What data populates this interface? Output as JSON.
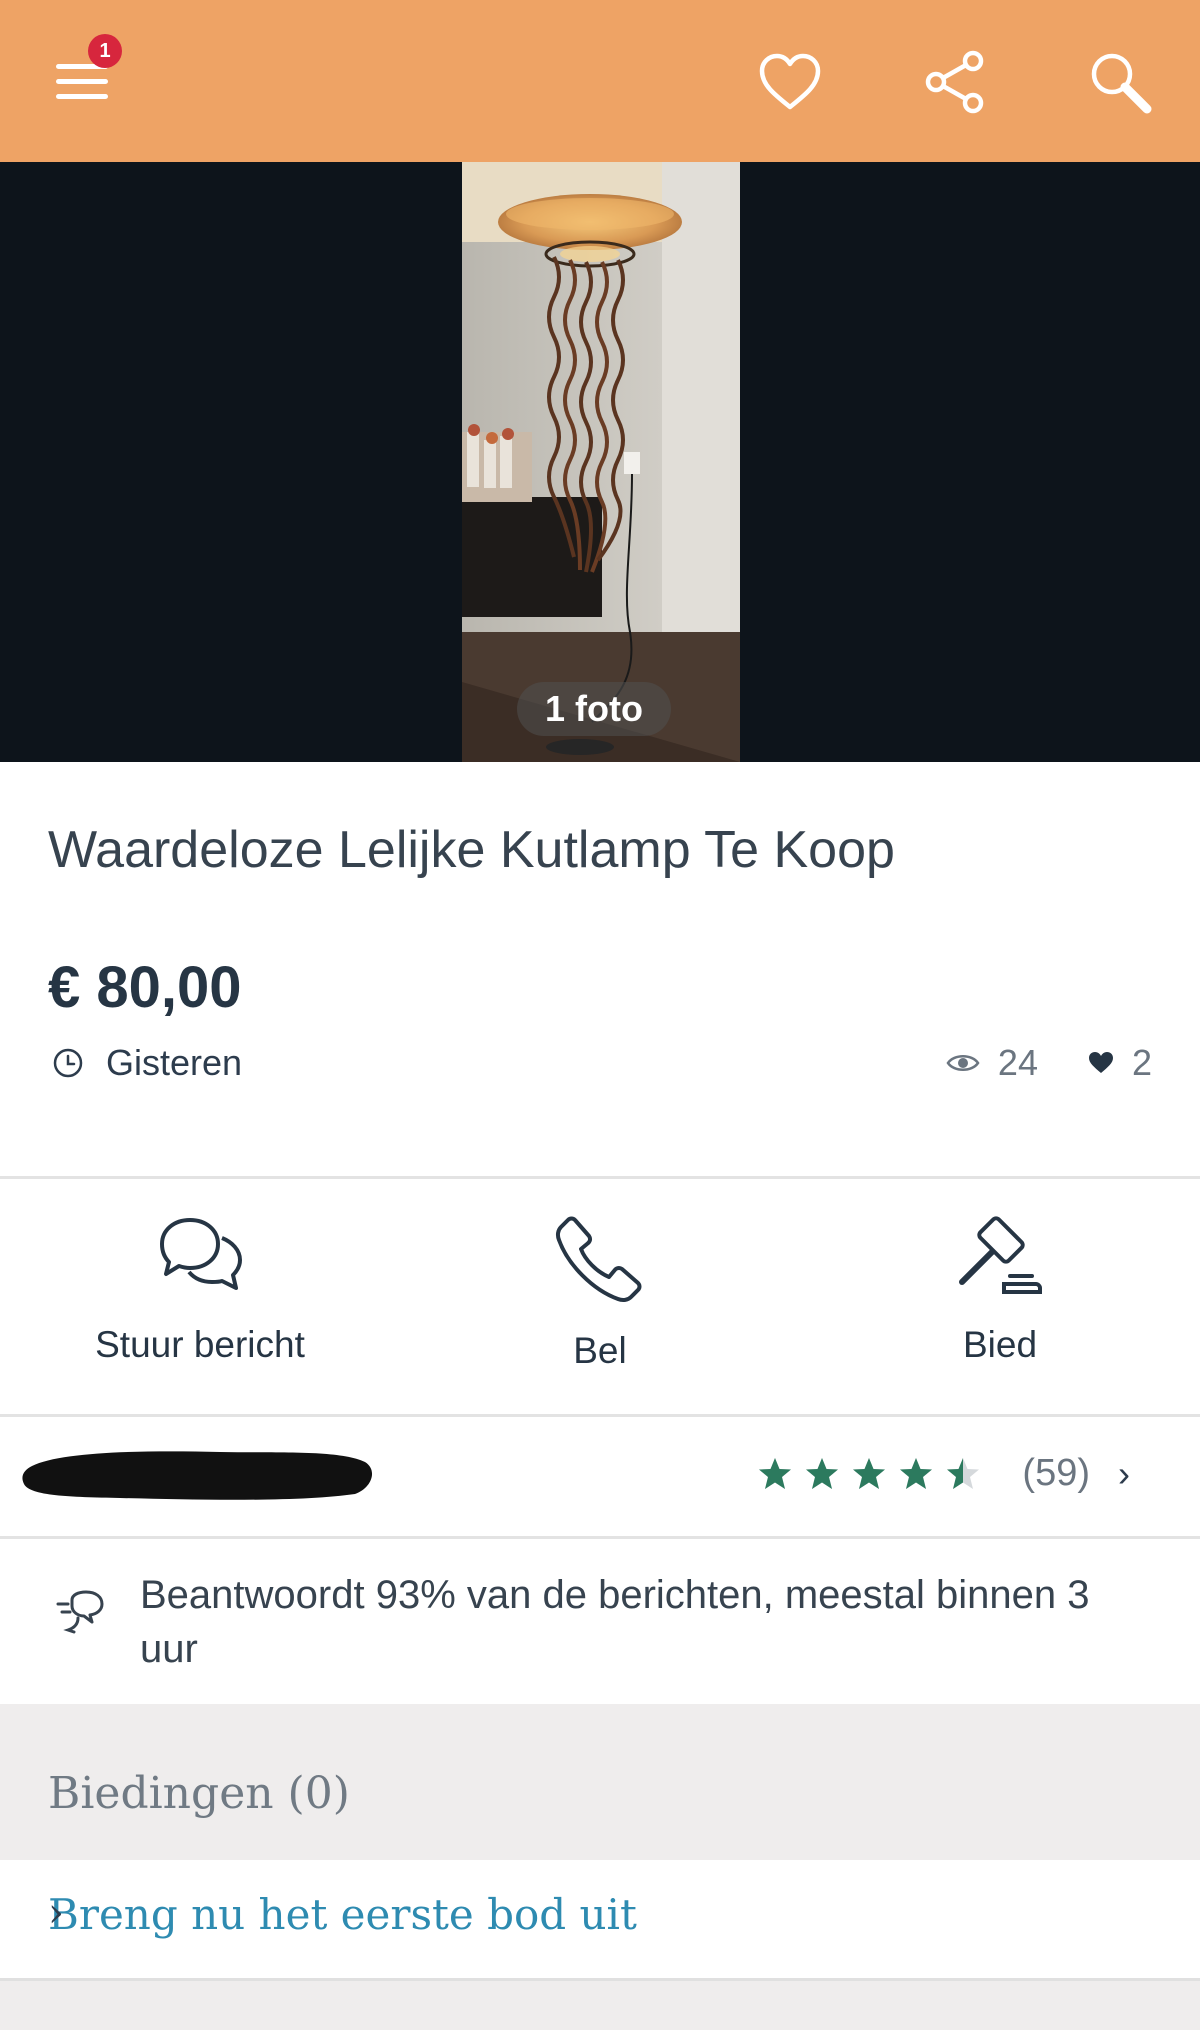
{
  "topbar": {
    "menu_icon": "hamburger-menu-icon",
    "notification_count": "1",
    "favorite_icon": "heart-outline-icon",
    "share_icon": "share-icon",
    "search_icon": "search-icon",
    "background_color": "#eea365"
  },
  "photo": {
    "count_label": "1 foto",
    "background_color": "#0d141b"
  },
  "listing": {
    "title": "Waardeloze Lelijke Kutlamp Te Koop",
    "price": "€ 80,00",
    "posted": "Gisteren",
    "views": "24",
    "favorites": "2"
  },
  "actions": [
    {
      "label": "Stuur bericht",
      "icon": "chat-bubbles-icon"
    },
    {
      "label": "Bel",
      "icon": "phone-icon"
    },
    {
      "label": "Bied",
      "icon": "auction-gavel-icon"
    }
  ],
  "seller": {
    "rating": 4.5,
    "rating_max": 5,
    "review_count": "(59)",
    "star_color": "#2c7a5e"
  },
  "response": {
    "text": "Beantwoordt 93% van de berichten, meestal binnen 3 uur"
  },
  "bids": {
    "header": "Biedingen (0)",
    "first_bid_link": "Breng nu het eerste bod uit",
    "link_color": "#2e8bb1"
  }
}
